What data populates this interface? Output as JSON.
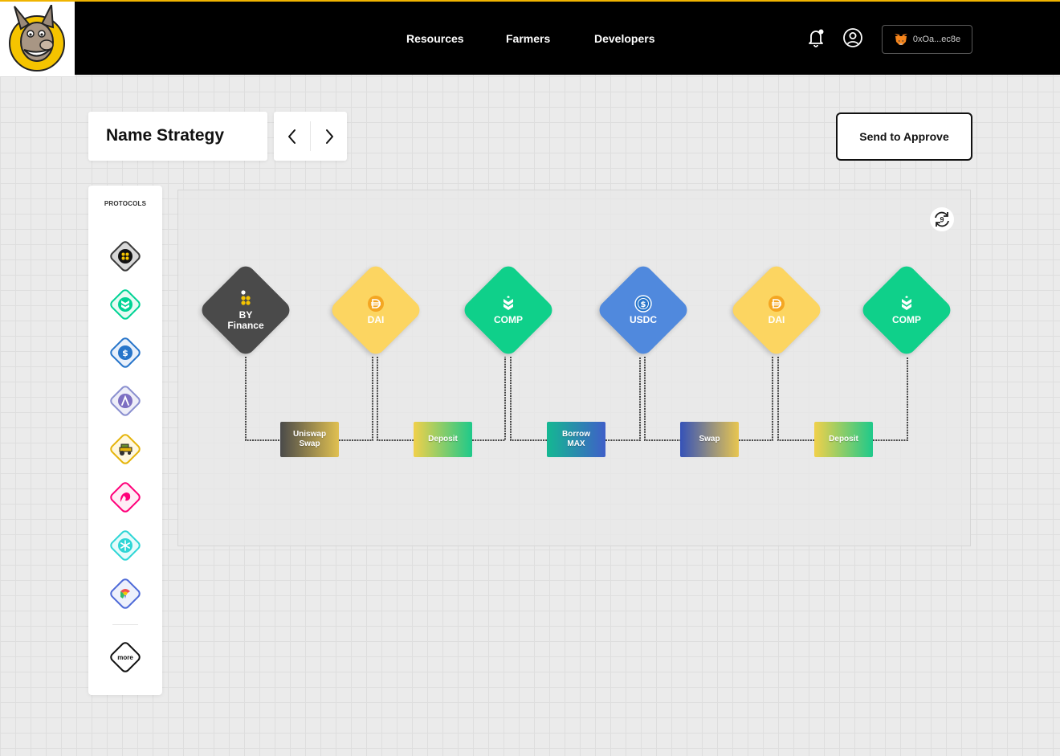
{
  "header": {
    "logo_name": "donkey-mascot-logo",
    "nav": [
      "Resources",
      "Farmers",
      "Developers"
    ],
    "wallet": {
      "address": "0xOa...ec8e",
      "icon": "metamask-fox-icon"
    },
    "icons": [
      "bell-notification-icon",
      "user-profile-icon"
    ]
  },
  "toolbar": {
    "strategy_name": "Name Strategy",
    "prev_icon": "chevron-left-icon",
    "next_icon": "chevron-right-icon",
    "send_label": "Send to Approve"
  },
  "sidebar": {
    "title": "PROTOCOLS",
    "protocols": [
      {
        "icon": "byfinance-icon",
        "color": "#3a3a3a"
      },
      {
        "icon": "compound-icon",
        "color": "#00d395"
      },
      {
        "icon": "usdc-icon",
        "color": "#2775ca"
      },
      {
        "icon": "aave-icon",
        "color": "#8a8fcf"
      },
      {
        "icon": "harvest-tractor-icon",
        "color": "#e5b40a"
      },
      {
        "icon": "uniswap-unicorn-icon",
        "color": "#ff007a"
      },
      {
        "icon": "curve-snowflake-icon",
        "color": "#2fd6d6"
      },
      {
        "icon": "rainbow-icon",
        "color": "#4e6ad8"
      }
    ],
    "more_label": "more"
  },
  "canvas": {
    "refresh_badge": "9",
    "nodes": [
      {
        "line1": "BY",
        "line2": "Finance",
        "icon": "byfinance-icon",
        "color": "#4a4a4a"
      },
      {
        "line1": "DAI",
        "line2": "",
        "icon": "dai-icon",
        "color": "#fcd561"
      },
      {
        "line1": "COMP",
        "line2": "",
        "icon": "compound-icon",
        "color": "#0fd08a"
      },
      {
        "line1": "USDC",
        "line2": "",
        "icon": "usdc-icon",
        "color": "#5089dd"
      },
      {
        "line1": "DAI",
        "line2": "",
        "icon": "dai-icon",
        "color": "#fcd561"
      },
      {
        "line1": "COMP",
        "line2": "",
        "icon": "compound-icon",
        "color": "#0fd08a"
      }
    ],
    "actions": [
      {
        "line1": "Uniswap",
        "line2": "Swap"
      },
      {
        "line1": "Deposit",
        "line2": ""
      },
      {
        "line1": "Borrow",
        "line2": "MAX"
      },
      {
        "line1": "Swap",
        "line2": ""
      },
      {
        "line1": "Deposit",
        "line2": ""
      }
    ]
  }
}
